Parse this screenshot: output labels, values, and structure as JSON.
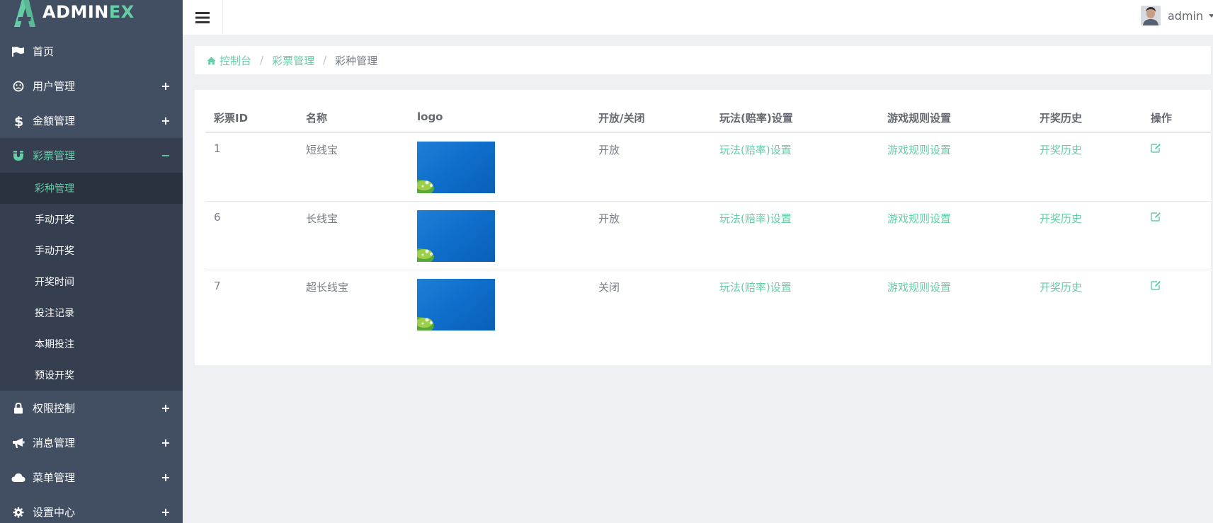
{
  "brand": {
    "name_main": "ADMIN",
    "name_accent": "EX"
  },
  "colors": {
    "sidebar_bg": "#424f63",
    "accent": "#65cea7",
    "content_bg": "#eff0f4"
  },
  "sidebar": {
    "items": [
      {
        "label": "首页",
        "icon": "flag-icon",
        "toggle": ""
      },
      {
        "label": "用户管理",
        "icon": "frown-icon",
        "toggle": "+"
      },
      {
        "label": "金额管理",
        "icon": "dollar-icon",
        "toggle": "+"
      },
      {
        "label": "彩票管理",
        "icon": "magnet-icon",
        "toggle": "−"
      },
      {
        "label": "权限控制",
        "icon": "lock-icon",
        "toggle": "+"
      },
      {
        "label": "消息管理",
        "icon": "bullhorn-icon",
        "toggle": "+"
      },
      {
        "label": "菜单管理",
        "icon": "cloud-icon",
        "toggle": "+"
      },
      {
        "label": "设置中心",
        "icon": "gear-icon",
        "toggle": "+"
      }
    ],
    "sub_items": [
      {
        "label": "彩种管理"
      },
      {
        "label": "手动开奖"
      },
      {
        "label": "手动开奖"
      },
      {
        "label": "开奖时间"
      },
      {
        "label": "投注记录"
      },
      {
        "label": "本期投注"
      },
      {
        "label": "预设开奖"
      }
    ]
  },
  "header": {
    "menu_icon": "bars-icon",
    "user_name": "admin"
  },
  "breadcrumb": {
    "home": "控制台",
    "section": "彩票管理",
    "current": "彩种管理"
  },
  "table": {
    "headers": [
      "彩票ID",
      "名称",
      "logo",
      "开放/关闭",
      "玩法(赔率)设置",
      "游戏规则设置",
      "开奖历史",
      "操作"
    ],
    "rows": [
      {
        "id": "1",
        "name": "短线宝",
        "status": "开放",
        "odds": "玩法(赔率)设置",
        "rules": "游戏规则设置",
        "history": "开奖历史"
      },
      {
        "id": "6",
        "name": "长线宝",
        "status": "开放",
        "odds": "玩法(赔率)设置",
        "rules": "游戏规则设置",
        "history": "开奖历史"
      },
      {
        "id": "7",
        "name": "超长线宝",
        "status": "关闭",
        "odds": "玩法(赔率)设置",
        "rules": "游戏规则设置",
        "history": "开奖历史"
      }
    ]
  }
}
